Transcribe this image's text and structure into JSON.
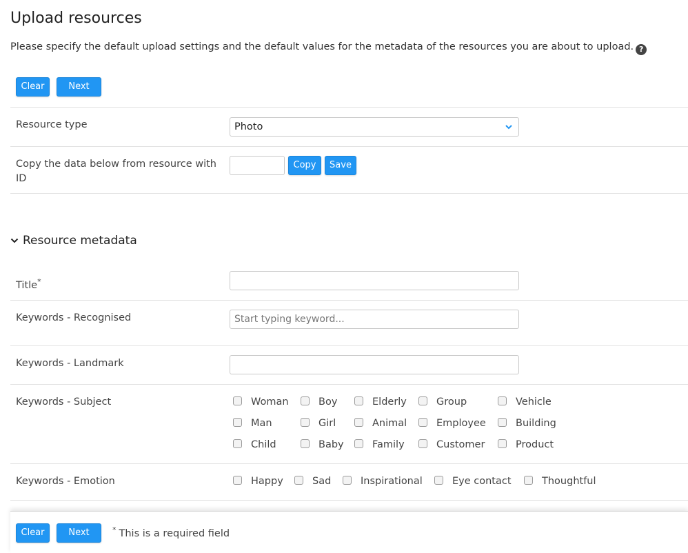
{
  "page": {
    "title": "Upload resources",
    "intro": "Please specify the default upload settings and the default values for the metadata of the resources you are about to upload.",
    "help_icon": "question-circle-icon"
  },
  "toolbar": {
    "clear_label": "Clear",
    "next_label": "Next"
  },
  "resource_type": {
    "label": "Resource type",
    "selected": "Photo"
  },
  "copy_data": {
    "label": "Copy the data below from resource with ID",
    "value": "",
    "copy_label": "Copy",
    "save_label": "Save"
  },
  "metadata": {
    "section_title": "Resource metadata",
    "title_field": {
      "label": "Title",
      "required_mark": "*",
      "value": ""
    },
    "keywords_recognised": {
      "label": "Keywords - Recognised",
      "placeholder": "Start typing keyword..."
    },
    "keywords_landmark": {
      "label": "Keywords - Landmark",
      "value": ""
    },
    "keywords_subject": {
      "label": "Keywords - Subject",
      "options": [
        "Woman",
        "Boy",
        "Elderly",
        "Group",
        "Vehicle",
        "Man",
        "Girl",
        "Animal",
        "Employee",
        "Building",
        "Child",
        "Baby",
        "Family",
        "Customer",
        "Product"
      ]
    },
    "keywords_emotion": {
      "label": "Keywords - Emotion",
      "options": [
        "Happy",
        "Sad",
        "Inspirational",
        "Eye contact",
        "Thoughtful"
      ]
    }
  },
  "footer": {
    "clear_label": "Clear",
    "next_label": "Next",
    "required_mark": "*",
    "required_note": "This is a required field"
  },
  "colors": {
    "accent": "#2196f3",
    "divider": "#e2e2e2"
  }
}
